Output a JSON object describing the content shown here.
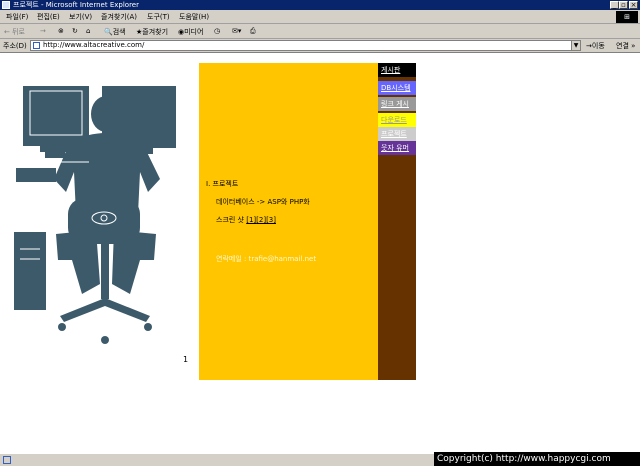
{
  "window": {
    "title": "프로젝트 - Microsoft Internet Explorer"
  },
  "menu": {
    "items": [
      "파일(F)",
      "편집(E)",
      "보기(V)",
      "즐겨찾기(A)",
      "도구(T)",
      "도움말(H)"
    ]
  },
  "toolbar": {
    "back": "← 뒤로",
    "forward": "→",
    "search": "검색",
    "favorites": "즐겨찾기",
    "media": "미디어"
  },
  "address": {
    "label": "주소(D)",
    "url": "http://www.altacreative.com/",
    "go": "이동",
    "links": "연결 »"
  },
  "colors": {
    "yellow": "#ffc600",
    "brown": "#663300",
    "figure": "#3d5a6b"
  },
  "nav": {
    "items": [
      {
        "label": "게시판",
        "bg": "#000000",
        "fg": "#ffffff"
      },
      {
        "label": "DB시스템",
        "bg": "#6666ff",
        "fg": "#ffffff"
      },
      {
        "label": "링크 게시",
        "bg": "#999999",
        "fg": "#ffffff"
      },
      {
        "label": "다운로드",
        "bg": "#ffff00",
        "fg": "#999999"
      },
      {
        "label": "프로젝트",
        "bg": "#cccccc",
        "fg": "#ffffff"
      },
      {
        "label": "웃자 유머",
        "bg": "#663399",
        "fg": "#ffffff"
      }
    ]
  },
  "content": {
    "heading": "I. 프로젝트",
    "item1": "데이터베이스 -> ASP와 PHP화",
    "item2_prefix": "스크린 샷 ",
    "screenshot_links": [
      "[1]",
      "[2]",
      "[3]"
    ],
    "contact": "연락메일 : trafie@hanmail.net"
  },
  "page_number": "1",
  "copyright": "Copyright(c) http://www.happycgi.com"
}
